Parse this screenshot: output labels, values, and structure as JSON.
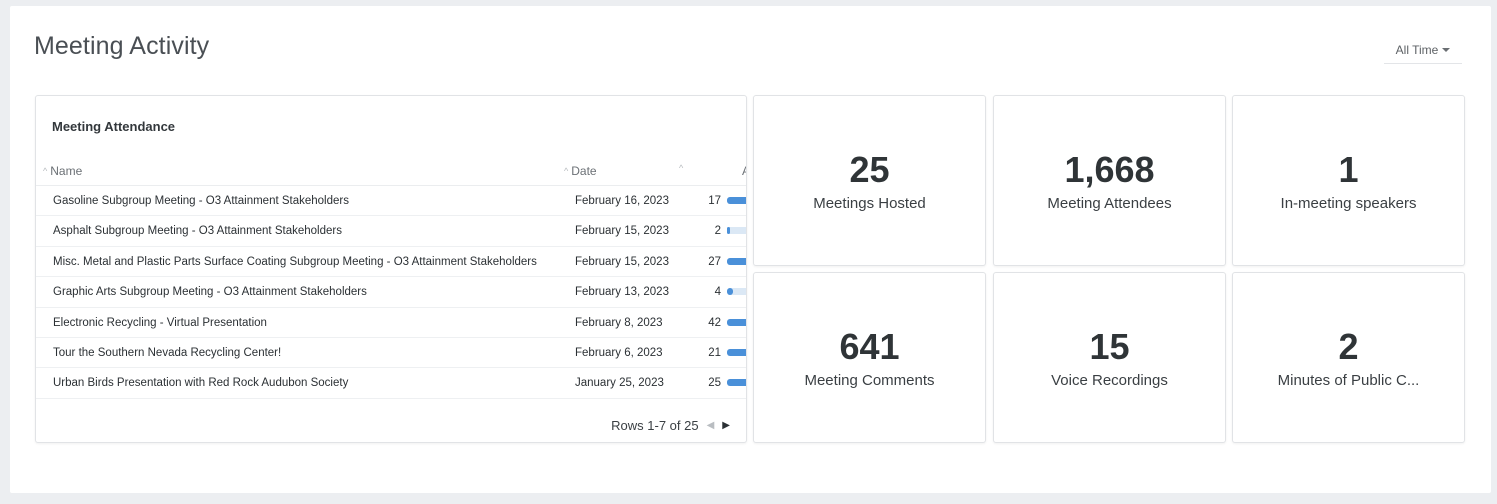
{
  "header": {
    "title": "Meeting Activity",
    "range": "All Time"
  },
  "attendance": {
    "title": "Meeting Attendance",
    "columns": {
      "name": "Name",
      "date": "Date",
      "extra": "A"
    },
    "rows": [
      {
        "name": "Gasoline Subgroup Meeting - O3 Attainment Stakeholders",
        "date": "February 16, 2023",
        "count": "17",
        "fraction": 0.4
      },
      {
        "name": "Asphalt Subgroup Meeting - O3 Attainment Stakeholders",
        "date": "February 15, 2023",
        "count": "2",
        "fraction": 0.05
      },
      {
        "name": "Misc. Metal and Plastic Parts Surface Coating Subgroup Meeting - O3 Attainment Stakeholders",
        "date": "February 15, 2023",
        "count": "27",
        "fraction": 0.64
      },
      {
        "name": "Graphic Arts Subgroup Meeting - O3 Attainment Stakeholders",
        "date": "February 13, 2023",
        "count": "4",
        "fraction": 0.1
      },
      {
        "name": "Electronic Recycling - Virtual Presentation",
        "date": "February 8, 2023",
        "count": "42",
        "fraction": 1.0
      },
      {
        "name": "Tour the Southern Nevada Recycling Center!",
        "date": "February 6, 2023",
        "count": "21",
        "fraction": 0.5
      },
      {
        "name": "Urban Birds Presentation with Red Rock Audubon Society",
        "date": "January 25, 2023",
        "count": "25",
        "fraction": 0.6
      }
    ],
    "pager": "Rows 1-7 of 25"
  },
  "stats": [
    {
      "value": "25",
      "label": "Meetings Hosted"
    },
    {
      "value": "1,668",
      "label": "Meeting Attendees"
    },
    {
      "value": "1",
      "label": "In-meeting speakers"
    },
    {
      "value": "641",
      "label": "Meeting Comments"
    },
    {
      "value": "15",
      "label": "Voice Recordings"
    },
    {
      "value": "2",
      "label": "Minutes of Public C..."
    }
  ],
  "colors": {
    "bar": "#4a90d9",
    "bar_track": "#dbe8f5"
  },
  "icons": {
    "sort": "sort-caret-icon",
    "prev": "chevron-left-icon",
    "next": "chevron-right-icon",
    "dropdown": "caret-down-icon"
  }
}
